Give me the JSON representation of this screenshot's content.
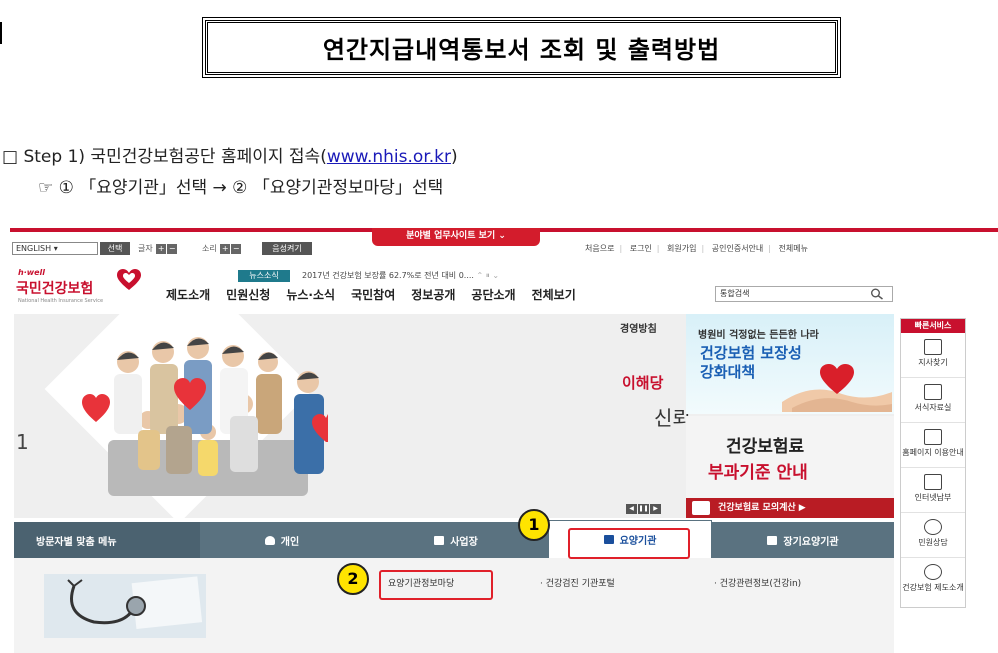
{
  "document": {
    "title": "연간지급내역통보서 조회 및 출력방법",
    "step_prefix": "□ Step 1) 국민건강보험공단 홈페이지 접속(",
    "step_url": "www.nhis.or.kr",
    "step_suffix": ")",
    "instruction": "☞ ① 「요양기관」선택 → ② 「요양기관정보마당」선택"
  },
  "site": {
    "region_button": "분야별 업무사이트 보기",
    "language_select": "ENGLISH",
    "select_button": "선택",
    "text_size_label": "글자",
    "sound_label": "소리",
    "plus": "+",
    "minus": "−",
    "voice_button": "음성켜기",
    "util_links": [
      "처음으로",
      "로그인",
      "회원가입",
      "공인인증서안내",
      "전체메뉴"
    ],
    "logo": {
      "tagline": "h·well",
      "name": "국민건강보험",
      "sub": "National Health Insurance Service"
    },
    "news_badge": "뉴스소식",
    "news_text": "2017년 건강보험 보장률 62.7%로 전년 대비 0....",
    "nav": [
      "제도소개",
      "민원신청",
      "뉴스·소식",
      "국민참여",
      "정보공개",
      "공단소개",
      "전체보기"
    ],
    "search_value": "통합검색",
    "hero": {
      "heading": "경영방침",
      "red_text": "이해당",
      "faded_text": "신뢰",
      "left_char": "1"
    },
    "banner1": {
      "line1": "병원비 걱정없는 든든한 나라",
      "line2": "건강보험 보장성",
      "line3": "강화대책"
    },
    "banner2": {
      "line1": "건강보험료",
      "line2": "부과기준 안내",
      "bar": "건강보험료 모의계산 ▶"
    },
    "quick": {
      "header": "빠른서비스",
      "items": [
        "지사찾기",
        "서식자료실",
        "홈페이지 이용안내",
        "인터넷납부",
        "민원상담",
        "건강보험 제도소개"
      ]
    },
    "tabs": {
      "first": "방문자별 맞춤 메뉴",
      "personal": "개인",
      "business": "사업장",
      "provider": "요양기관",
      "longterm": "장기요양기관"
    },
    "sublinks": [
      "요양기관정보마당",
      "· 건강검진 기관포털",
      "· 건강관련정보(건강in)"
    ]
  },
  "annotations": {
    "badge1": "1",
    "badge2": "2"
  },
  "colors": {
    "brand_red": "#c8102e",
    "tab_bar": "#5a7280",
    "accent_blue": "#1a4f9c",
    "highlight": "#e0202a",
    "badge_yellow": "#ffe400"
  }
}
